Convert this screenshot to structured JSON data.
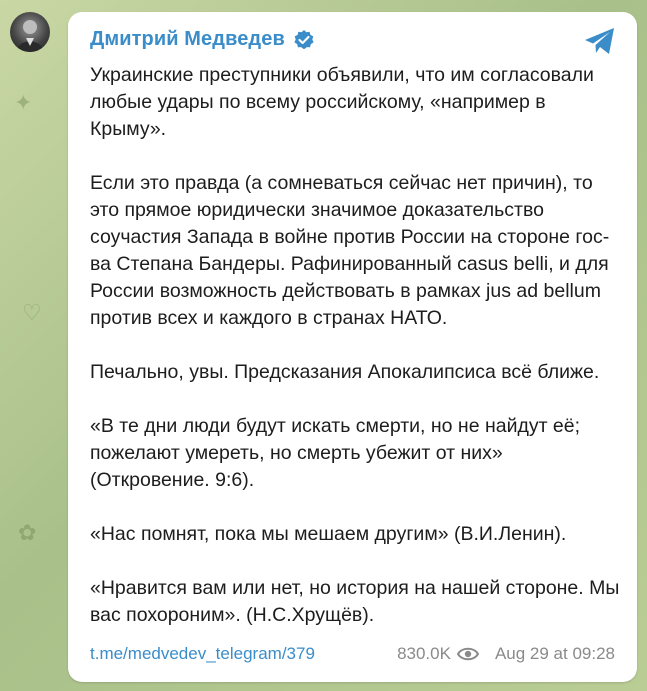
{
  "channel": {
    "name": "Дмитрий Медведев",
    "verified": true
  },
  "post": {
    "paragraphs": [
      "Украинские преступники объявили, что им согласовали любые удары по всему российскому, «например в Крыму».",
      "Если это правда (а сомневаться сейчас нет причин), то это прямое юридически значимое доказательство соучастия Запада в войне против России на стороне гос-ва Степана Бандеры. Рафинированный casus belli, и для России возможность действовать в рамках jus ad bellum против всех и каждого в странах НАТО.",
      "Печально, увы. Предсказания Апокалипсиса всё ближе.",
      "«В те дни люди будут искать смерти, но не найдут её; пожелают умереть, но смерть убежит от них» (Откровение. 9:6).",
      "«Нас помнят, пока мы мешаем другим» (В.И.Ленин).",
      "«Нравится вам или нет, но история на нашей стороне. Мы вас похороним». (Н.С.Хрущёв)."
    ],
    "link": "t.me/medvedev_telegram/379",
    "views": "830.0K",
    "date": "Aug 29 at 09:28"
  },
  "icons": {
    "avatar": "avatar",
    "verified": "verified-check-icon",
    "share": "telegram-plane-icon",
    "views": "eye-icon"
  },
  "colors": {
    "accent": "#3a8dc9",
    "meta": "#8a8a8a",
    "text": "#1d1d1d",
    "background": "#b9cd94"
  }
}
